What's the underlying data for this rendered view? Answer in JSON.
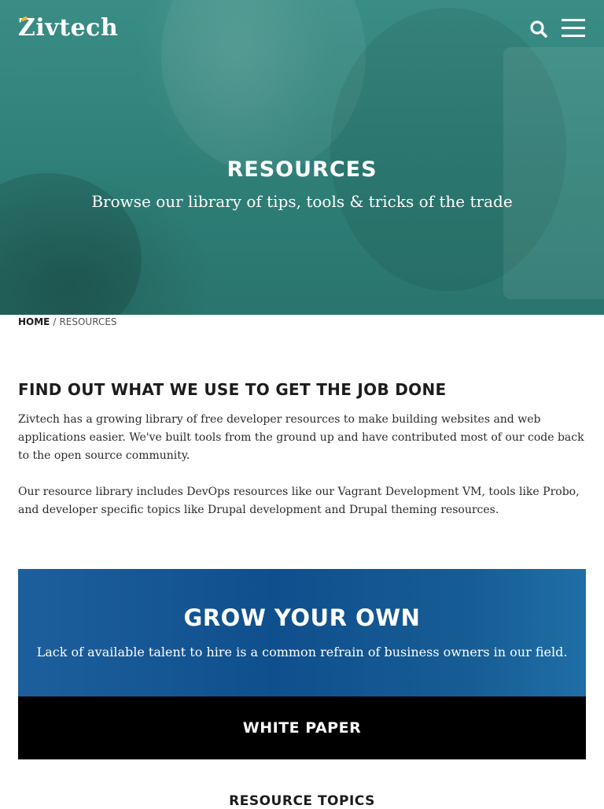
{
  "header": {
    "logo_text": "Zivtech",
    "search_icon": "search-icon",
    "menu_icon": "hamburger-menu-icon"
  },
  "hero": {
    "title": "RESOURCES",
    "subtitle": "Browse our library of tips, tools & tricks of the trade",
    "overlay_color": "#2e7f77"
  },
  "breadcrumb": {
    "home": "HOME",
    "separator": "/",
    "current": "RESOURCES"
  },
  "intro": {
    "heading": "FIND OUT WHAT WE USE TO GET THE JOB DONE",
    "paragraph1": "Zivtech has a growing library of free developer resources to make building websites and web applications easier. We've built tools from the ground up and have contributed most of our code back to the open source community.",
    "paragraph2": "Our resource library includes DevOps resources like our Vagrant Development VM, tools like Probo, and developer specific topics like Drupal development and Drupal theming resources."
  },
  "promo": {
    "title": "GROW YOUR OWN",
    "subtitle": "Lack of available talent to hire is a common refrain of business owners in our field.",
    "button_label": "WHITE PAPER",
    "background_color": "#0f4f8d",
    "button_color": "#000000"
  },
  "topics": {
    "heading": "RESOURCE TOPICS"
  },
  "colors": {
    "accent": "#f2b33d",
    "text_dark": "#1c1c1c"
  }
}
